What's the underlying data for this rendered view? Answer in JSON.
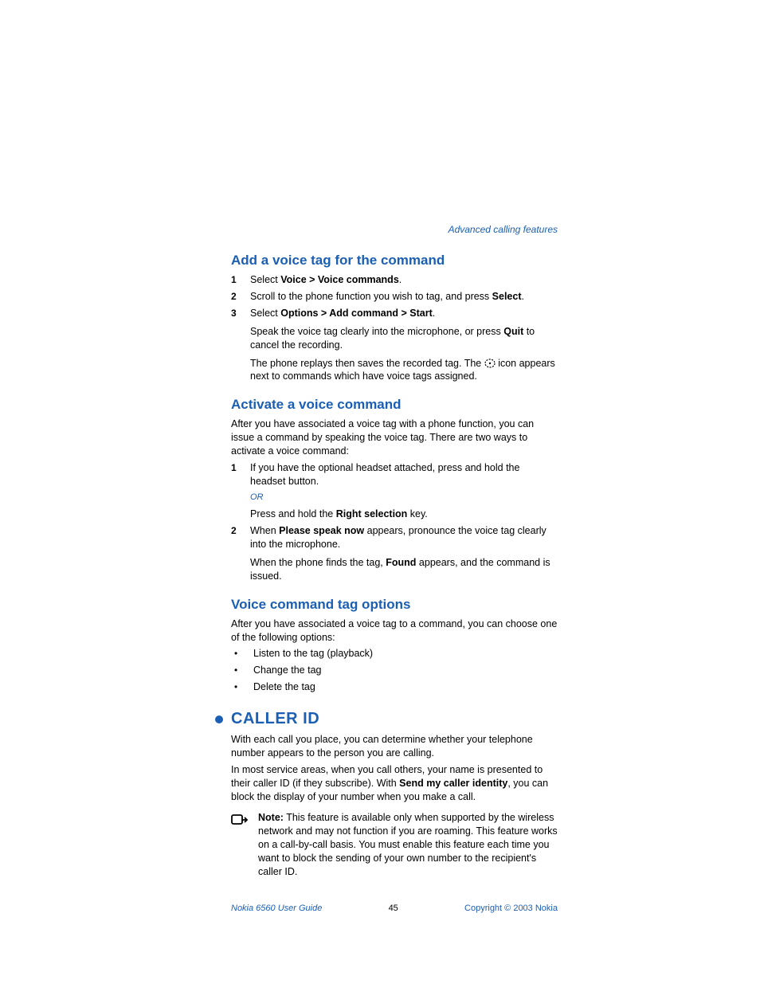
{
  "header": "Advanced calling features",
  "s1": {
    "title": "Add a voice tag for the command",
    "steps": [
      {
        "n": "1",
        "pre": "Select ",
        "b": "Voice > Voice commands",
        "post": "."
      },
      {
        "n": "2",
        "pre": "Scroll to the phone function you wish to tag, and press ",
        "b": "Select",
        "post": "."
      },
      {
        "n": "3",
        "pre": "Select ",
        "b": "Options > Add command > Start",
        "post": "."
      }
    ],
    "sub1_pre": "Speak the voice tag clearly into the microphone, or press ",
    "sub1_b": "Quit",
    "sub1_post": " to cancel the recording.",
    "sub2_pre": "The phone replays then saves the recorded tag. The ",
    "sub2_post": " icon appears next to commands which have voice tags assigned."
  },
  "s2": {
    "title": "Activate a voice command",
    "intro": "After you have associated a voice tag with a phone function, you can issue a command by speaking the voice tag. There are two ways to activate a voice command:",
    "step1_n": "1",
    "step1_text": "If you have the optional headset attached, press and hold the headset button.",
    "or": "OR",
    "or_sub_pre": "Press and hold the ",
    "or_sub_b": "Right selection",
    "or_sub_post": " key.",
    "step2_n": "2",
    "step2_pre": "When ",
    "step2_b": "Please speak now",
    "step2_post": " appears, pronounce the voice tag clearly into the microphone.",
    "sub_pre": "When the phone finds the tag, ",
    "sub_b": "Found",
    "sub_post": " appears, and the command is issued."
  },
  "s3": {
    "title": "Voice command tag options",
    "intro": "After you have associated a voice tag to a command, you can choose one of the following options:",
    "bullets": [
      "Listen to the tag (playback)",
      "Change the tag",
      "Delete the tag"
    ]
  },
  "s4": {
    "title": "CALLER ID",
    "p1": "With each call you place, you can determine whether your telephone number appears to the person you are calling.",
    "p2_pre": "In most service areas, when you call others, your name is presented to their caller ID (if they subscribe). With ",
    "p2_b": "Send my caller identity",
    "p2_post": ", you can block the display of your number when you make a call.",
    "note_label": "Note:",
    "note_text": " This feature is available only when supported by the wireless network and may not function if you are roaming. This feature works on a call-by-call basis. You must enable this feature each time you want to block the sending of your own number to the recipient's caller ID."
  },
  "footer": {
    "left": "Nokia 6560 User Guide",
    "center": "45",
    "right": "Copyright © 2003 Nokia"
  }
}
